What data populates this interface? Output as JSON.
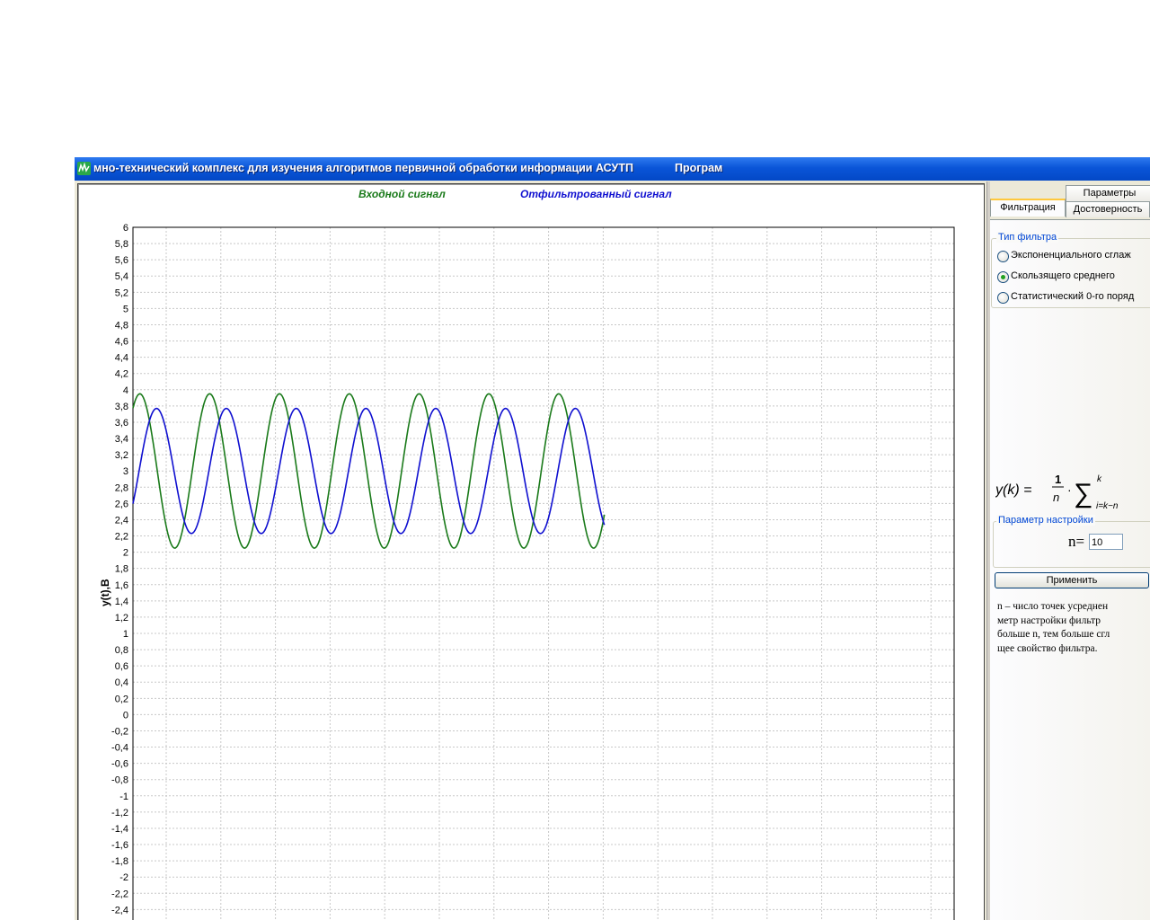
{
  "window": {
    "title": "мно-технический комплекс  для изучения алгоритмов первичной обработки информации АСУТП",
    "menu_label": "Програм",
    "app_icon": "app-logo-icon"
  },
  "colors": {
    "input_signal": "#1a7a1a",
    "filtered_signal": "#1010d0",
    "titlebar": "#0a55d8",
    "grid": "#c8c8c8"
  },
  "chart_data": {
    "type": "line",
    "ylabel": "y(t),B",
    "ylim": [
      -2.4,
      6
    ],
    "y_ticks": [
      "6",
      "5,8",
      "5,6",
      "5,4",
      "5,2",
      "5",
      "4,8",
      "4,6",
      "4,4",
      "4,2",
      "4",
      "3,8",
      "3,6",
      "3,4",
      "3,2",
      "3",
      "2,8",
      "2,6",
      "2,4",
      "2,2",
      "2",
      "1,8",
      "1,6",
      "1,4",
      "1,2",
      "1",
      "0,8",
      "0,6",
      "0,4",
      "0,2",
      "0",
      "-0,2",
      "-0,4",
      "-0,6",
      "-0,8",
      "-1",
      "-1,2",
      "-1,4",
      "-1,6",
      "-1,8",
      "-2",
      "-2,2",
      "-2,4"
    ],
    "grid": true,
    "legend_position": "top",
    "series": [
      {
        "name": "Входной сигнал",
        "color": "#1a7a1a",
        "offset": 3.0,
        "amplitude": 0.95,
        "period": 7.33,
        "phase": 0.95,
        "x_start": 0,
        "x_end": 49.5
      },
      {
        "name": "Отфильтрованный сигнал",
        "color": "#1010d0",
        "offset": 3.0,
        "amplitude": 0.77,
        "period": 7.33,
        "phase": -0.55,
        "x_start": 0,
        "x_end": 49.5
      }
    ]
  },
  "side_panel": {
    "tabs": [
      "Параметры",
      "Фильтрация",
      "Достоверность"
    ],
    "active_tab": "Фильтрация",
    "filter_group": {
      "label": "Тип фильтра",
      "options": [
        "Экспоненциального сглаж",
        "Скользящего среднего",
        "Статистический 0-го поряд"
      ],
      "selected": "Скользящего среднего"
    },
    "formula": "y(k) = 1/n · Σ i=k−n..k",
    "param_group": {
      "label": "Параметр настройки",
      "n_label": "n=",
      "n_value": "10"
    },
    "apply_label": "Применить",
    "description_lines": [
      "n – число точек усреднен",
      "метр настройки фильтр",
      "больше n, тем больше сгл",
      "щее свойство фильтра."
    ]
  }
}
